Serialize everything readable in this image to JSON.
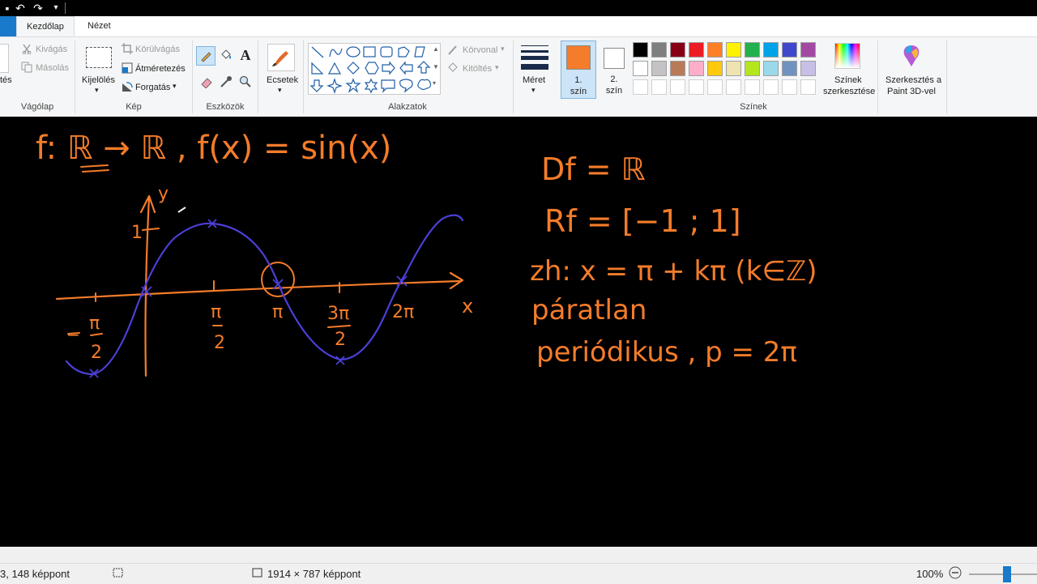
{
  "tabs": {
    "home": "Kezdőlap",
    "view": "Nézet"
  },
  "clipboard": {
    "paste_partial": "tés",
    "cut": "Kivágás",
    "copy": "Másolás",
    "group": "Vágólap"
  },
  "image": {
    "select": "Kijelölés",
    "crop": "Körülvágás",
    "resize": "Átméretezés",
    "rotate": "Forgatás",
    "group": "Kép"
  },
  "tools": {
    "group": "Eszközök"
  },
  "brushes": {
    "label": "Ecsetek"
  },
  "shapes": {
    "outline": "Körvonal",
    "fill": "Kitöltés",
    "group": "Alakzatok"
  },
  "size": {
    "label": "Méret"
  },
  "color1": {
    "line1": "1.",
    "line2": "szín",
    "value": "#f47c2a"
  },
  "color2": {
    "line1": "2.",
    "line2": "szín",
    "value": "#ffffff"
  },
  "colors": {
    "group": "Színek",
    "edit_line1": "Színek",
    "edit_line2": "szerkesztése",
    "row1": [
      "#000000",
      "#7f7f7f",
      "#880015",
      "#ed1c24",
      "#ff7f27",
      "#fff200",
      "#22b14c",
      "#00a2e8",
      "#3f48cc",
      "#a349a4"
    ],
    "row2": [
      "#ffffff",
      "#c3c3c3",
      "#b97a57",
      "#ffaec9",
      "#ffc90e",
      "#efe4b0",
      "#b5e61d",
      "#99d9ea",
      "#7092be",
      "#c8bfe7"
    ]
  },
  "paint3d": {
    "line1": "Szerkesztés a",
    "line2": "Paint 3D-vel"
  },
  "status": {
    "cursor": "3, 148 képpont",
    "dimensions": "1914 × 787 képpont",
    "zoom": "100%"
  },
  "drawing": {
    "stroke_orange": "#f47c2a",
    "stroke_blue": "#4b3fd6",
    "axis_x": "x",
    "axis_y": "y",
    "one": "1",
    "minus": "−",
    "pi": "π",
    "two": "2",
    "three_pi": "3π",
    "two_pi": "2π",
    "f_def": "f: ℝ → ℝ , f(x) = sin(x)",
    "domain": "Df = ℝ",
    "range": "Rf = [−1 ; 1]",
    "zeros": "zh: x = π + kπ (k∈ℤ)",
    "odd": "páratlan",
    "periodic": "periódikus , p = 2π"
  }
}
